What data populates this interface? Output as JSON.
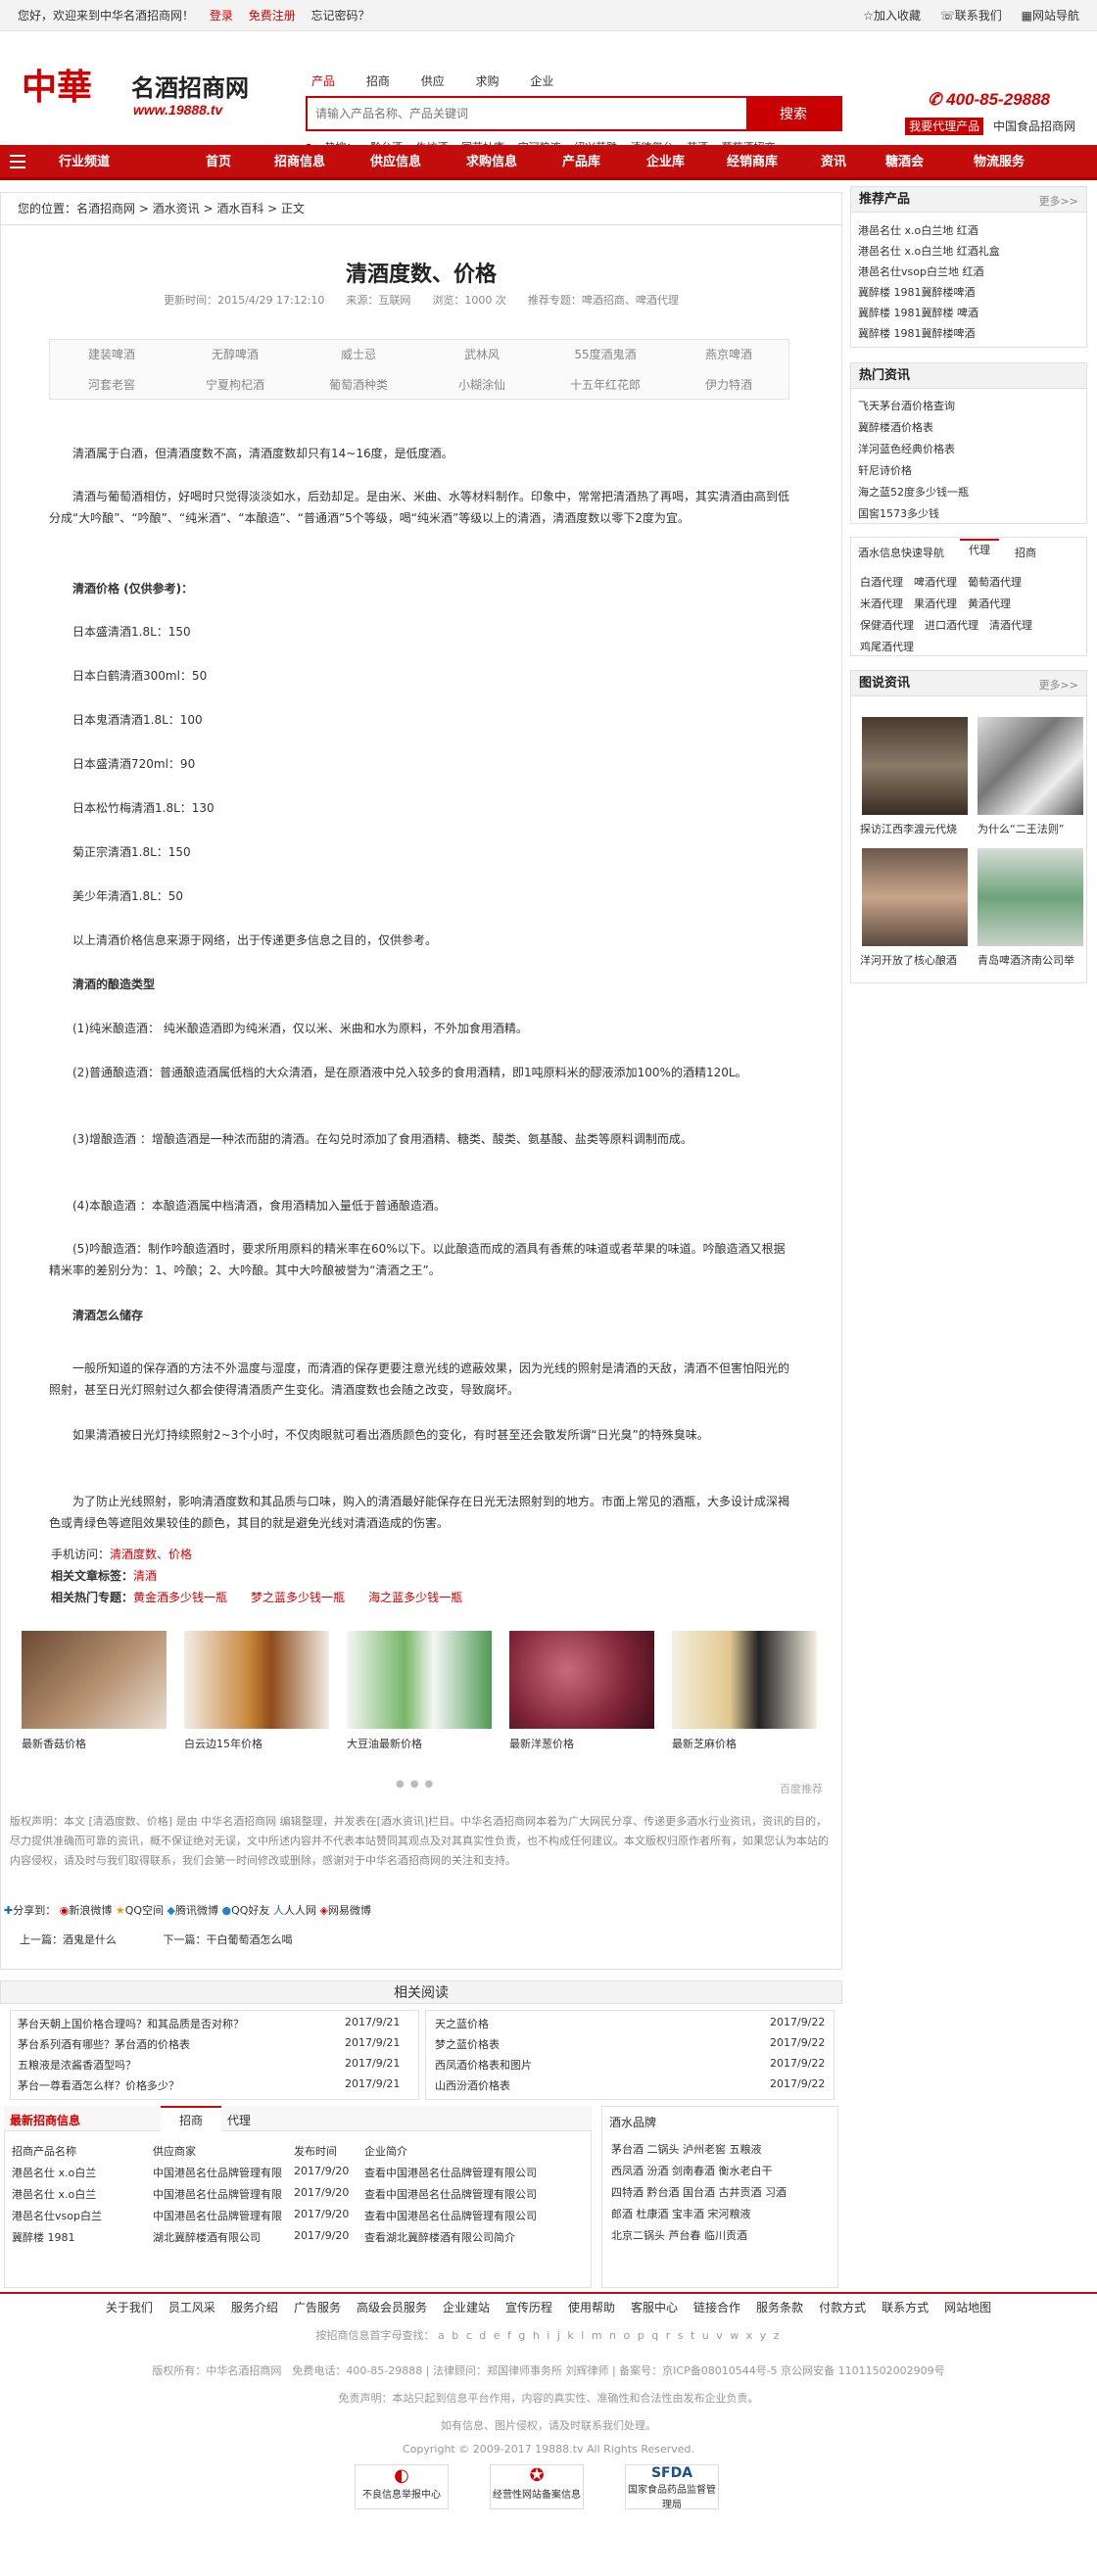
{
  "top": {
    "welcome": "您好，欢迎来到中华名酒招商网！",
    "login": "登录",
    "register": "免费注册",
    "forgot": "忘记密码？",
    "fav": "加入收藏",
    "contact": "联系我们",
    "sitemap": "网站导航"
  },
  "logo": {
    "big": "中華",
    "cn": "名酒招商网",
    "url": "www.19888.tv"
  },
  "search": {
    "tabs": [
      "产品",
      "招商",
      "供应",
      "求购",
      "企业"
    ],
    "placeholder": "请输入产品名称、产品关键词",
    "button": "搜索",
    "hot_label": "热搜：",
    "hot": [
      "黔台酒",
      "牛坊酒",
      "国花杜康",
      "宋河粮液",
      "绍兴花雕",
      "清德玺台",
      "苏酒",
      "葡萄酒招商"
    ]
  },
  "header": {
    "phone": "400-85-29888",
    "agent": "我要代理产品",
    "tagline": "中国食品招商网"
  },
  "nav": [
    "行业频道",
    "首页",
    "招商信息",
    "供应信息",
    "求购信息",
    "产品库",
    "企业库",
    "经销商库",
    "资讯",
    "糖酒会",
    "物流服务"
  ],
  "crumb": "您的位置：名酒招商网 > 酒水资讯 > 酒水百科 > 正文",
  "article": {
    "title": "清酒度数、价格",
    "meta": "更新时间：2015/4/29 17:12:10　　来源：互联网　　浏览：1000 次　　推荐专题：啤酒招商、啤酒代理"
  },
  "tags": [
    "建装啤酒",
    "无醇啤酒",
    "威士忌",
    "武林风",
    "55度酒鬼酒",
    "燕京啤酒",
    "河套老窖",
    "宁夏枸杞酒",
    "葡萄酒种类",
    "小糊涂仙",
    "十五年红花郎",
    "伊力特酒"
  ],
  "paras": [
    "清酒属于白酒，但清酒度数不高，清酒度数却只有14~16度，是低度酒。",
    "清酒与葡萄酒相仿，好喝时只觉得淡淡如水，后劲却足。是由米、米曲、水等材料制作。印象中，常常把清酒热了再喝，其实清酒由高到低分成“大吟酿”、“吟酿”、“纯米酒”、“本酿造”、“普通酒”5个等级，喝“纯米酒”等级以上的清酒，清酒度数以零下2度为宜。",
    "清酒价格 (仅供参考)：",
    "日本盛清酒1.8L：150",
    "日本白鹤清酒300ml：50",
    "日本鬼酒清酒1.8L：100",
    "日本盛清酒720ml：90",
    "日本松竹梅清酒1.8L：130",
    "菊正宗清酒1.8L：150",
    "美少年清酒1.8L：50",
    "以上清酒价格信息来源于网络，出于传递更多信息之目的，仅供参考。",
    "清酒的酿造类型",
    "(1)纯米酿造酒： 纯米酿造酒即为纯米酒，仅以米、米曲和水为原料，不外加食用酒精。",
    "(2)普通酿造酒：普通酿造酒属低档的大众清酒，是在原酒液中兑入较多的食用酒精，即1吨原料米的醪液添加100%的酒精120L。",
    "(3)增酿造酒 ：增酿造酒是一种浓而甜的清酒。在勾兑时添加了食用酒精、糖类、酸类、氨基酸、盐类等原料调制而成。",
    "(4)本酿造酒 ：本酿造酒属中档清酒，食用酒精加入量低于普通酿造酒。",
    "(5)吟酿造酒：制作吟酿造酒时，要求所用原料的精米率在60%以下。以此酿造而成的酒具有香蕉的味道或者苹果的味道。吟酿造酒又根据精米率的差别分为：1、吟酿；2、大吟酿。其中大吟酿被誉为“清酒之王”。",
    "清酒怎么储存",
    "一般所知道的保存酒的方法不外温度与湿度，而清酒的保存更要注意光线的遮蔽效果，因为光线的照射是清酒的天敌，清酒不但害怕阳光的照射，甚至日光灯照射过久都会使得清酒质产生变化。清酒度数也会随之改变，导致腐坏。",
    "如果清酒被日光灯持续照射2~3个小时，不仅肉眼就可看出酒质颜色的变化，有时甚至还会散发所谓“日光臭”的特殊臭味。",
    "为了防止光线照射，影响清酒度数和其品质与口味，购入的清酒最好能保存在日光无法照射到的地方。市面上常见的酒瓶，大多设计成深褐色或青绿色等遮阻效果较佳的颜色，其目的就是避免光线对清酒造成的伤害。"
  ],
  "links": {
    "mobile_label": "手机访问：",
    "mobile": "清酒度数、价格",
    "tag_label": "相关文章标签：",
    "tag": "清酒",
    "topic_label": "相关热门专题：",
    "topics": [
      "黄金酒多少钱一瓶",
      "梦之蓝多少钱一瓶",
      "海之蓝多少钱一瓶"
    ]
  },
  "gallery": {
    "items": [
      "最新香菇价格",
      "白云边15年价格",
      "大豆油最新价格",
      "最新洋葱价格",
      "最新芝麻价格"
    ],
    "hint": "百度推荐"
  },
  "notice": "版权声明：本文 [清酒度数、价格] 是由 中华名酒招商网 编辑整理，并发表在[酒水资讯]栏目。中华名酒招商网本着为广大网民分享、传递更多酒水行业资讯，资讯的目的，尽力提供准确而可靠的资讯，概不保证绝对无误，文中所述内容并不代表本站赞同其观点及对其真实性负责，也不构成任何建议。本文版权归原作者所有，如果您认为本站的内容侵权，请及时与我们取得联系，我们会第一时间修改或删除，感谢对于中华名酒招商网的关注和支持。",
  "share": {
    "label": "分享到：",
    "items": [
      "新浪微博",
      "QQ空间",
      "腾讯微博",
      "QQ好友",
      "人人网",
      "网易微博"
    ]
  },
  "prevnext": {
    "prev_label": "上一篇：",
    "prev": "酒鬼是什么",
    "next_label": "下一篇：",
    "next": "干白葡萄酒怎么喝"
  },
  "related": {
    "title": "相关阅读",
    "left": [
      [
        "茅台天朝上国价格合理吗？和其品质是否对称？",
        "2017/9/21"
      ],
      [
        "茅台系列酒有哪些？茅台酒的价格表",
        "2017/9/21"
      ],
      [
        "五粮液是浓酱香酒型吗？",
        "2017/9/21"
      ],
      [
        "茅台一尊看酒怎么样？价格多少？",
        "2017/9/21"
      ]
    ],
    "right": [
      [
        "天之蓝价格",
        "2017/9/22"
      ],
      [
        "梦之蓝价格表",
        "2017/9/22"
      ],
      [
        "西凤酒价格表和图片",
        "2017/9/22"
      ],
      [
        "山西汾酒价格表",
        "2017/9/22"
      ]
    ]
  },
  "latest": {
    "title": "最新招商信息",
    "tabs": [
      "招商",
      "代理"
    ],
    "headers": [
      "招商产品名称",
      "供应商家",
      "发布时间",
      "企业简介"
    ],
    "rows": [
      [
        "港邑名仕 x.o白兰",
        "中国港邑名仕品牌管理有限",
        "2017/9/20",
        "查看中国港邑名仕品牌管理有限公司"
      ],
      [
        "港邑名仕 x.o白兰",
        "中国港邑名仕品牌管理有限",
        "2017/9/20",
        "查看中国港邑名仕品牌管理有限公司"
      ],
      [
        "港邑名仕vsop白兰",
        "中国港邑名仕品牌管理有限",
        "2017/9/20",
        "查看中国港邑名仕品牌管理有限公司"
      ],
      [
        "冀醉楼 1981",
        "湖北冀醉楼酒有限公司",
        "2017/9/20",
        "查看湖北冀醉楼酒有限公司简介"
      ]
    ]
  },
  "brands": {
    "title": "酒水品牌",
    "items": [
      "茅台酒",
      "二锅头",
      "泸州老窖",
      "五粮液",
      "西凤酒",
      "汾酒",
      "剑南春酒",
      "衡水老白干",
      "四特酒",
      "黔台酒",
      "国台酒",
      "古井贡酒",
      "习酒",
      "郎酒",
      "杜康酒",
      "宝丰酒",
      "宋河粮液",
      "北京二锅头",
      "芦台春",
      "临川贡酒"
    ]
  },
  "side": {
    "rec_title": "推荐产品",
    "more": "更多>>",
    "rec": [
      "港邑名仕 x.o白兰地 红酒",
      "港邑名仕 x.o白兰地 红酒礼盒",
      "港邑名仕vsop白兰地 红酒",
      "冀醉楼 1981冀醉楼啤酒",
      "冀醉楼 1981冀醉楼 啤酒",
      "冀醉楼 1981冀醉楼啤酒"
    ],
    "hot_title": "热门资讯",
    "hot": [
      "飞天茅台酒价格查询",
      "冀醉楼酒价格表",
      "洋河蓝色经典价格表",
      "轩尼诗价格",
      "海之蓝52度多少钱一瓶",
      "国窖1573多少钱"
    ],
    "nav_title": "酒水信息快速导航",
    "nav_tabs": [
      "代理",
      "招商"
    ],
    "nav_items": [
      "白酒代理",
      "啤酒代理",
      "葡萄酒代理",
      "米酒代理",
      "果酒代理",
      "黄酒代理",
      "保健酒代理",
      "进口酒代理",
      "清酒代理",
      "鸡尾酒代理"
    ],
    "pic_title": "图说资讯",
    "pics": [
      "探访江西李渡元代烧",
      "为什么“二王法则”",
      "洋河开放了核心酿酒",
      "青岛啤酒济南公司举"
    ]
  },
  "footer": {
    "links": [
      "关于我们",
      "员工风采",
      "服务介绍",
      "广告服务",
      "高级会员服务",
      "企业建站",
      "宣传历程",
      "使用帮助",
      "客服中心",
      "链接合作",
      "服务条款",
      "付款方式",
      "联系方式",
      "网站地图"
    ],
    "letters_label": "按招商信息首字母查找：",
    "letters": "a b c d e f g h i j k l m n o p q r s t u v w x y z",
    "copy1": "版权所有：中华名酒招商网　免费电话：400-85-29888 | 法律顾问：郑国律师事务所 刘辉律师 | 备案号：京ICP备08010544号-5 京公网安备 11011502002909号",
    "copy2": "免责声明：本站只起到信息平台作用，内容的真实性、准确性和合法性由发布企业负责。",
    "copy3": "如有信息、图片侵权，请及时联系我们处理。",
    "copy4": "Copyright © 2009-2017 19888.tv All Rights Reserved.",
    "badges": [
      "不良信息举报中心",
      "经营性网站备案信息",
      "国家食品药品监督管理局"
    ]
  },
  "colors": {
    "brand": "#c30c0c",
    "accent": "#d40000"
  }
}
